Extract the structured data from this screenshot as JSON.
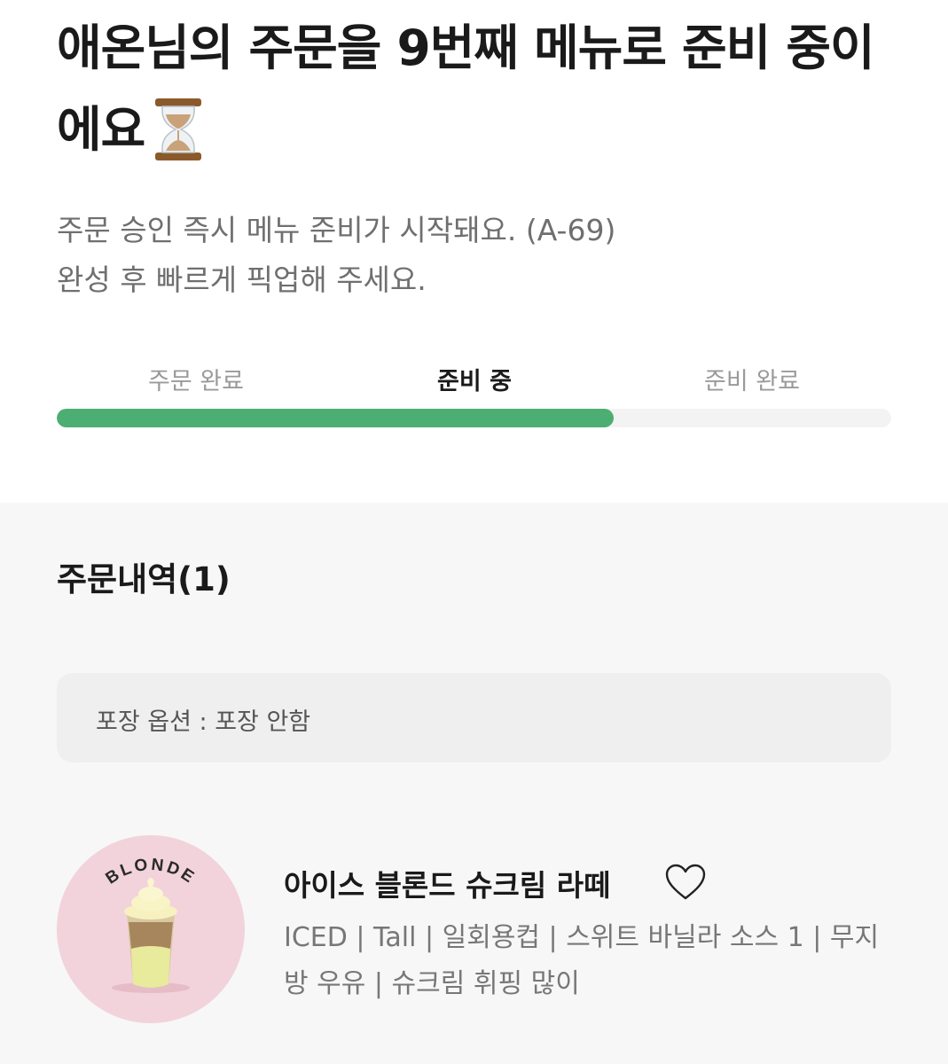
{
  "header": {
    "title": "애온님의 주문을 9번째 메뉴로 준비 중이에요",
    "title_icon": "hourglass-icon",
    "subtitle_line1": "주문 승인 즉시 메뉴 준비가 시작돼요. (A-69)",
    "subtitle_line2": "완성 후 빠르게 픽업해 주세요."
  },
  "progress": {
    "steps": [
      {
        "label": "주문 완료",
        "state": "done"
      },
      {
        "label": "준비 중",
        "state": "current"
      },
      {
        "label": "준비 완료",
        "state": "pending"
      }
    ],
    "fraction": 0.667,
    "color": "#4cae72"
  },
  "order": {
    "section_title": "주문내역(1)",
    "packaging_option": "포장 옵션 : 포장 안함",
    "item": {
      "name": "아이스 블론드 슈크림 라떼",
      "options": "ICED | Tall | 일회용컵 | 스위트 바닐라 소스 1 | 무지방 우유 | 슈크림 휘핑 많이",
      "badge_text": "BLONDE",
      "favorite_icon": "heart-outline-icon"
    }
  }
}
